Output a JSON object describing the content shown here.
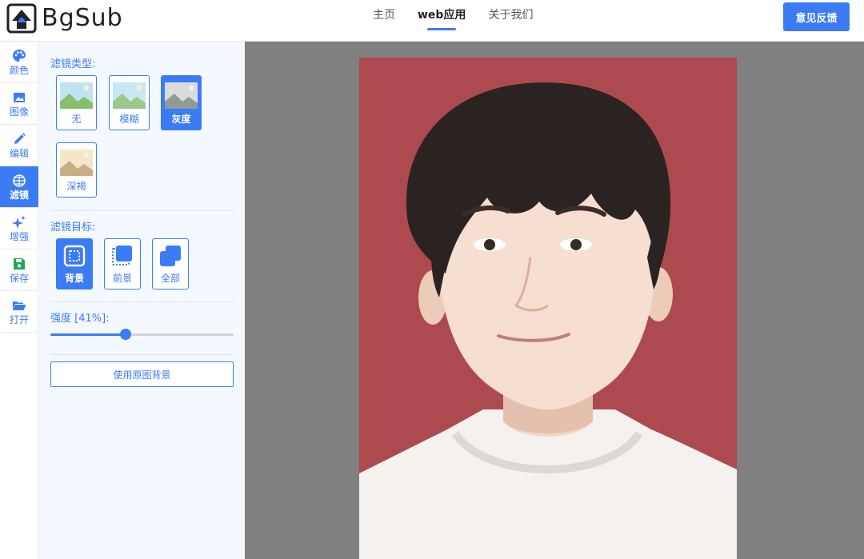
{
  "header": {
    "logo_text": "BgSub",
    "nav": [
      {
        "label": "主页",
        "active": false
      },
      {
        "label": "web应用",
        "active": true
      },
      {
        "label": "关于我们",
        "active": false
      }
    ],
    "feedback_label": "意见反馈"
  },
  "rail": {
    "items": [
      {
        "label": "颜色",
        "icon": "palette-icon",
        "active": false
      },
      {
        "label": "图像",
        "icon": "image-icon",
        "active": false
      },
      {
        "label": "编辑",
        "icon": "pencil-icon",
        "active": false
      },
      {
        "label": "滤镜",
        "icon": "filter-icon",
        "active": true
      },
      {
        "label": "增强",
        "icon": "sparkle-icon",
        "active": false
      },
      {
        "label": "保存",
        "icon": "save-icon",
        "active": false
      },
      {
        "label": "打开",
        "icon": "folder-open-icon",
        "active": false
      }
    ]
  },
  "panel": {
    "filter_type_title": "滤镜类型:",
    "filters": [
      {
        "label": "无",
        "active": false
      },
      {
        "label": "模糊",
        "active": false
      },
      {
        "label": "灰度",
        "active": true
      },
      {
        "label": "深褐",
        "active": false
      }
    ],
    "filter_target_title": "滤镜目标:",
    "targets": [
      {
        "label": "背景",
        "active": true
      },
      {
        "label": "前景",
        "active": false
      },
      {
        "label": "全部",
        "active": false
      }
    ],
    "intensity_label": "强度 [41%]:",
    "intensity_value": 0.41,
    "use_original_bg_label": "使用原图背景"
  },
  "colors": {
    "accent": "#3b7cf6",
    "panel_bg": "#f4f8ff",
    "canvas_bg": "#808080",
    "photo_bg": "#ac4a50"
  }
}
